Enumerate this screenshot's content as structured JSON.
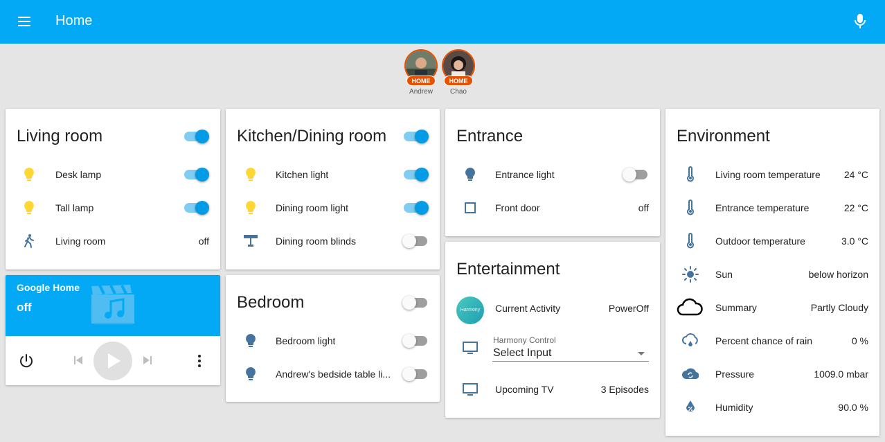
{
  "app": {
    "title": "Home"
  },
  "people": [
    {
      "name": "Andrew",
      "state": "HOME"
    },
    {
      "name": "Chao",
      "state": "HOME"
    }
  ],
  "living_room": {
    "title": "Living room",
    "items": [
      {
        "label": "Desk lamp",
        "type": "toggle",
        "on": true,
        "icon": "lightbulb-icon"
      },
      {
        "label": "Tall lamp",
        "type": "toggle",
        "on": true,
        "icon": "lightbulb-icon"
      },
      {
        "label": "Living room",
        "value": "off",
        "icon": "walk-icon"
      }
    ]
  },
  "media_player": {
    "name": "Google Home",
    "state": "off",
    "icons": [
      "power-icon",
      "skip-previous-icon",
      "play-icon",
      "skip-next-icon",
      "more-vertical-icon"
    ]
  },
  "kitchen": {
    "title": "Kitchen/Dining room",
    "items": [
      {
        "label": "Kitchen light",
        "type": "toggle",
        "on": true
      },
      {
        "label": "Dining room light",
        "type": "toggle",
        "on": true
      },
      {
        "label": "Dining room blinds",
        "type": "toggle",
        "on": false
      }
    ]
  },
  "bedroom": {
    "title": "Bedroom",
    "items": [
      {
        "label": "Bedroom light",
        "type": "toggle",
        "on": false
      },
      {
        "label": "Andrew's bedside table li...",
        "type": "toggle",
        "on": false
      }
    ]
  },
  "entrance": {
    "title": "Entrance",
    "items": [
      {
        "label": "Entrance light",
        "type": "toggle",
        "on": false
      },
      {
        "label": "Front door",
        "value": "off"
      }
    ]
  },
  "entertainment": {
    "title": "Entertainment",
    "current_activity": {
      "label": "Current Activity",
      "value": "PowerOff",
      "logo_text": "Harmony"
    },
    "harmony_control": {
      "label": "Harmony Control",
      "value": "Select Input"
    },
    "upcoming_tv": {
      "label": "Upcoming TV",
      "value": "3 Episodes"
    }
  },
  "environment": {
    "title": "Environment",
    "items": [
      {
        "label": "Living room temperature",
        "value": "24 °C"
      },
      {
        "label": "Entrance temperature",
        "value": "22 °C"
      },
      {
        "label": "Outdoor temperature",
        "value": "3.0 °C"
      },
      {
        "label": "Sun",
        "value": "below horizon"
      },
      {
        "label": "Summary",
        "value": "Partly Cloudy"
      },
      {
        "label": "Percent chance of rain",
        "value": "0 %"
      },
      {
        "label": "Pressure",
        "value": "1009.0 mbar"
      },
      {
        "label": "Humidity",
        "value": "90.0 %"
      }
    ]
  },
  "colors": {
    "header": "#03a9f4",
    "toggle_on": "#039be5",
    "bulb_on": "#fdd835",
    "icon": "#44739e",
    "badge": "#e65100"
  }
}
